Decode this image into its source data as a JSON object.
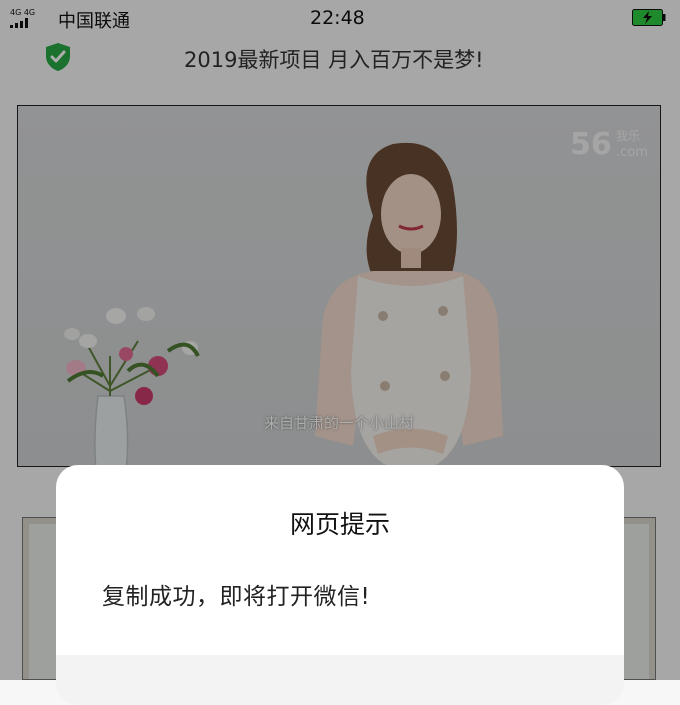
{
  "status_bar": {
    "network_label": "4G 4G",
    "carrier": "中国联通",
    "time": "22:48",
    "battery_color": "#2ecc40"
  },
  "page": {
    "title": "2019最新项目 月入百万不是梦!",
    "secure_icon": "shield-check-icon",
    "secure_color": "#27a844"
  },
  "video": {
    "watermark": "56.com 我乐",
    "subtitle": "来自甘肃的一个小山村"
  },
  "dialog": {
    "title": "网页提示",
    "message": "复制成功，即将打开微信!"
  }
}
